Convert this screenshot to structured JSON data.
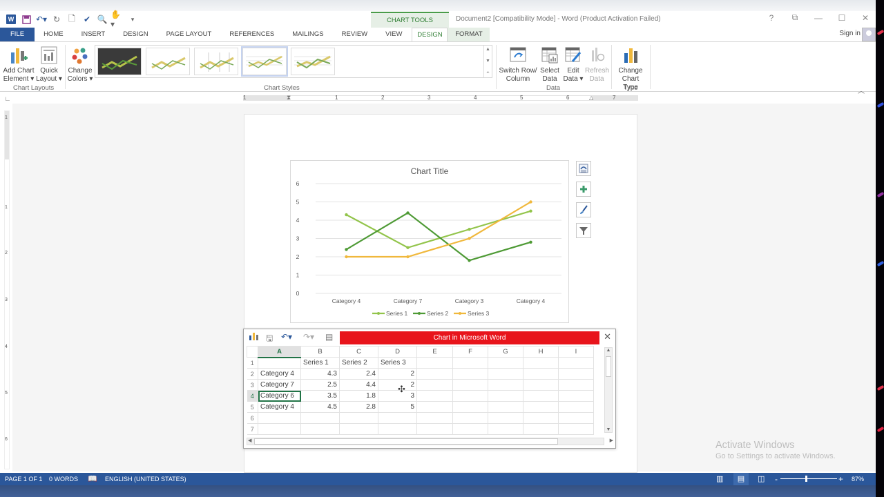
{
  "window": {
    "title": "Document2 [Compatibility Mode] - Word (Product Activation Failed)",
    "contextual_group": "CHART TOOLS",
    "sign_in": "Sign in",
    "controls": [
      "?",
      "⧉",
      "—",
      "☐",
      "✕"
    ]
  },
  "quick_access": [
    "word-logo",
    "save",
    "undo",
    "redo",
    "new",
    "spelling",
    "print-preview",
    "touch-mode",
    "customize"
  ],
  "tabs": [
    {
      "label": "FILE",
      "kind": "file"
    },
    {
      "label": "HOME"
    },
    {
      "label": "INSERT"
    },
    {
      "label": "DESIGN"
    },
    {
      "label": "PAGE LAYOUT"
    },
    {
      "label": "REFERENCES"
    },
    {
      "label": "MAILINGS"
    },
    {
      "label": "REVIEW"
    },
    {
      "label": "VIEW"
    },
    {
      "label": "DESIGN",
      "kind": "contextual",
      "active": true
    },
    {
      "label": "FORMAT",
      "kind": "contextual"
    }
  ],
  "ribbon": {
    "chart_layouts": {
      "label": "Chart Layouts",
      "add_chart_element": [
        "Add Chart",
        "Element ▾"
      ],
      "quick_layout": [
        "Quick",
        "Layout ▾"
      ]
    },
    "change_colors": [
      "Change",
      "Colors ▾"
    ],
    "chart_styles": {
      "label": "Chart Styles",
      "selected_index": 3,
      "count": 5
    },
    "data": {
      "label": "Data",
      "switch_row_column": [
        "Switch Row/",
        "Column"
      ],
      "select_data": [
        "Select",
        "Data"
      ],
      "edit_data": [
        "Edit",
        "Data ▾"
      ],
      "refresh_data": [
        "Refresh",
        "Data"
      ]
    },
    "type": {
      "label": "Type",
      "change_chart_type": [
        "Change",
        "Chart Type"
      ]
    }
  },
  "ruler": {
    "horizontal": [
      "1",
      "1",
      "2",
      "3",
      "4",
      "5",
      "6",
      "7"
    ],
    "vertical": [
      "1",
      "1",
      "2",
      "3",
      "4",
      "5",
      "6"
    ]
  },
  "chart_data": {
    "type": "line",
    "title": "Chart Title",
    "categories": [
      "Category 4",
      "Category 7",
      "Category 3",
      "Category 4"
    ],
    "series": [
      {
        "name": "Series 1",
        "values": [
          4.3,
          2.5,
          3.5,
          4.5
        ],
        "color": "#92c44a"
      },
      {
        "name": "Series 2",
        "values": [
          2.4,
          4.4,
          1.8,
          2.8
        ],
        "color": "#4e9a35"
      },
      {
        "name": "Series 3",
        "values": [
          2.0,
          2.0,
          3.0,
          5.0
        ],
        "color": "#f0b83c"
      }
    ],
    "ylim": [
      0,
      6
    ],
    "yticks": [
      "0",
      "1",
      "2",
      "3",
      "4",
      "5",
      "6"
    ],
    "xlabel": "",
    "ylabel": "",
    "grid": true,
    "legend": "bottom"
  },
  "chart_side_buttons": [
    "layout-options",
    "chart-elements",
    "chart-styles",
    "chart-filters"
  ],
  "spreadsheet": {
    "title": "Chart in Microsoft Word",
    "columns": [
      "A",
      "B",
      "C",
      "D",
      "E",
      "F",
      "G",
      "H",
      "I"
    ],
    "selected_column": "A",
    "selected_row": 4,
    "rows": [
      {
        "num": "1",
        "cells": [
          "",
          "Series 1",
          "Series 2",
          "Series 3",
          "",
          "",
          "",
          "",
          ""
        ]
      },
      {
        "num": "2",
        "cells": [
          "Category 4",
          "4.3",
          "2.4",
          "2",
          "",
          "",
          "",
          "",
          ""
        ]
      },
      {
        "num": "3",
        "cells": [
          "Category 7",
          "2.5",
          "4.4",
          "2",
          "",
          "",
          "",
          "",
          ""
        ]
      },
      {
        "num": "4",
        "cells": [
          "Category 6",
          "3.5",
          "1.8",
          "3",
          "",
          "",
          "",
          "",
          ""
        ]
      },
      {
        "num": "5",
        "cells": [
          "Category 4",
          "4.5",
          "2.8",
          "5",
          "",
          "",
          "",
          "",
          ""
        ]
      },
      {
        "num": "6",
        "cells": [
          "",
          "",
          "",
          "",
          "",
          "",
          "",
          "",
          ""
        ]
      },
      {
        "num": "7",
        "cells": [
          "",
          "",
          "",
          "",
          "",
          "",
          "",
          "",
          ""
        ]
      }
    ]
  },
  "watermark": {
    "line1": "Activate Windows",
    "line2": "Go to Settings to activate Windows."
  },
  "status": {
    "page": "PAGE 1 OF 1",
    "words": "0 WORDS",
    "language": "ENGLISH (UNITED STATES)",
    "zoom": "87%",
    "zoom_minus": "-",
    "zoom_plus": "+"
  },
  "colors": {
    "word_blue": "#2b579a",
    "chart_tools_green": "#2e7d32",
    "excel_green": "#217346",
    "title_red": "#e8141b"
  }
}
